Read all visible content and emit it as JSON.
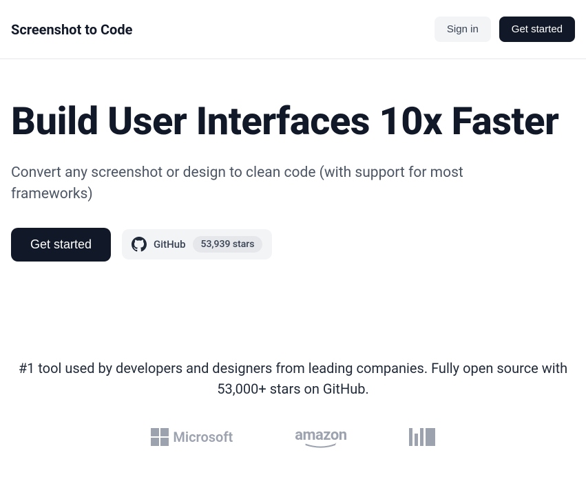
{
  "header": {
    "brand": "Screenshot to Code",
    "sign_in": "Sign in",
    "get_started": "Get started"
  },
  "hero": {
    "title": "Build User Interfaces 10x Faster",
    "subtitle": "Convert any screenshot or design to clean code (with support for most frameworks)",
    "cta": "Get started",
    "github_label": "GitHub",
    "github_stars": "53,939 stars"
  },
  "social": {
    "text": "#1 tool used by developers and designers from leading companies. Fully open source with 53,000+ stars on GitHub.",
    "logos": {
      "microsoft": "Microsoft",
      "amazon": "amazon",
      "mit": "MIT"
    }
  }
}
